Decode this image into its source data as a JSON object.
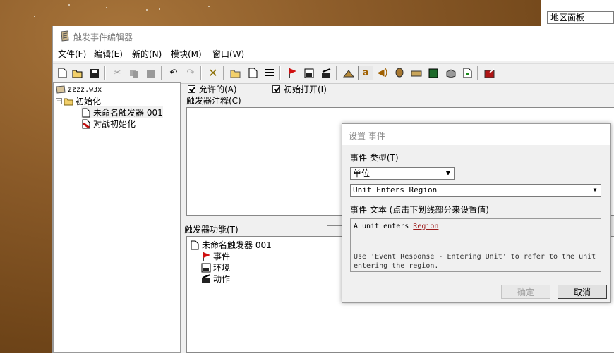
{
  "region_panel": {
    "field_text": "地区面板"
  },
  "editor": {
    "title": "触发事件编辑器",
    "menu": [
      "文件(F)",
      "编辑(E)",
      "新的(N)",
      "模块(M)",
      "窗口(W)"
    ],
    "tree": {
      "root": "zzzz.w3x",
      "category": "初始化",
      "items": [
        "未命名触发器 001",
        "对战初始化"
      ]
    },
    "enabled_label": "允许的(A)",
    "initially_on_label": "初始打开(I)",
    "comment_label": "触发器注释(C)",
    "functions_label": "触发器功能(T)",
    "functions_tree": {
      "trigger": "未命名触发器 001",
      "events": "事件",
      "conditions": "环境",
      "actions": "动作"
    }
  },
  "dialog": {
    "title": "设置 事件",
    "type_label": "事件 类型(T)",
    "type_value": "单位",
    "event_value": "Unit Enters Region",
    "text_label": "事件 文本 (点击下划线部分来设置值)",
    "event_text_prefix": "A unit enters ",
    "event_text_link": "Region",
    "event_hint": "Use 'Event Response - Entering Unit' to refer to the unit entering the region.",
    "ok_label": "确定",
    "cancel_label": "取消"
  },
  "colors": {
    "link": "#9b1c1c",
    "desktop": "#8a5a28"
  }
}
